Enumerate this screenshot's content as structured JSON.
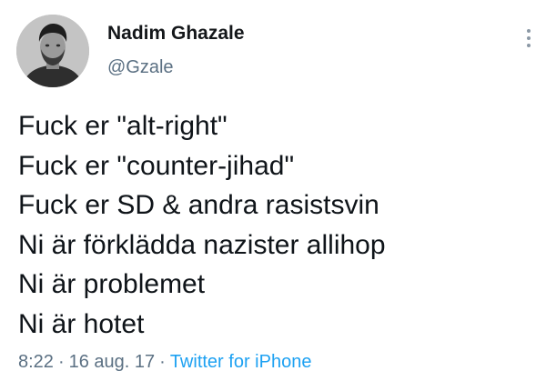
{
  "author": {
    "display_name": "Nadim Ghazale",
    "handle": "@Gzale",
    "avatar_icon": "profile-photo"
  },
  "more_icon": "more-vertical-icon",
  "tweet": {
    "lines": [
      "Fuck er \"alt-right\"",
      "Fuck er \"counter-jihad\"",
      "Fuck er SD & andra rasistsvin",
      "Ni är förklädda nazister allihop",
      "Ni är problemet",
      "Ni är hotet"
    ]
  },
  "meta": {
    "time": "8:22",
    "separator": "·",
    "date": "16 aug. 17",
    "source": "Twitter for iPhone"
  },
  "colors": {
    "text": "#0f1419",
    "secondary": "#5b7083",
    "link": "#1da1f2",
    "background": "#ffffff"
  }
}
